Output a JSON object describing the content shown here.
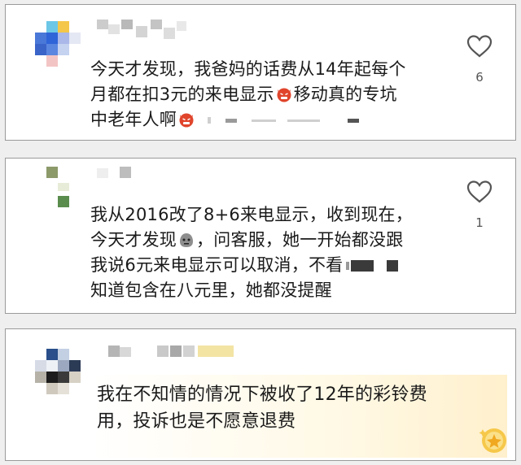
{
  "comments": [
    {
      "lines": [
        "今天才发现，我爸妈的话费从14年起每个",
        "月都在扣3元的来电显示",
        "移动真的专坑",
        "中老年人啊"
      ],
      "emoji": "angry-devil-emoji",
      "likes": "6"
    },
    {
      "lines": [
        "我从2016改了8+6来电显示，收到现在，",
        "今天才发现",
        "，问客服，她一开始都没跟",
        "我说6元来电显示可以取消，不看",
        "知道包含在八元里，她都没提醒"
      ],
      "emoji": "speechless-face-emoji",
      "likes": "1"
    },
    {
      "lines": [
        "我在不知情的情况下被收了12年的彩铃费",
        "用，投诉也是不愿意退费"
      ],
      "badge": "sparkle-badge-icon"
    }
  ],
  "colors": {
    "card_border": "#9a9a9a",
    "background": "#efefef",
    "text": "#1a1a1a",
    "like_count": "#555555",
    "highlight": "#fff0cd"
  }
}
